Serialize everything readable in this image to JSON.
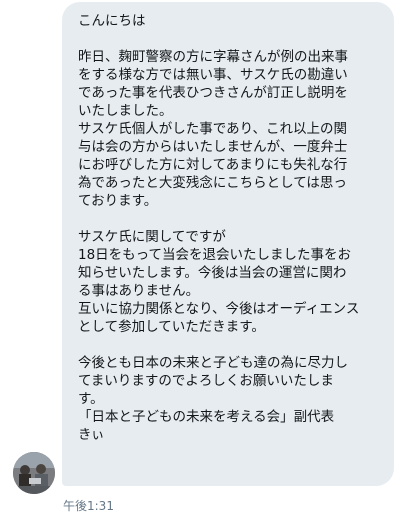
{
  "message": {
    "text": "こんにちは\n\n昨日、麹町警察の方に字幕さんが例の出来事\nをする様な方では無い事、サスケ氏の勘違い\nであった事を代表ひつきさんが訂正し説明を\nいたしました。\nサスケ氏個人がした事であり、これ以上の関\n与は会の方からはいたしませんが、一度弁士\nにお呼びした方に対してあまりにも失礼な行\n為であったと大変残念にこちらとしては思っ\nております。\n\nサスケ氏に関してですが\n18日をもって当会を退会いたしました事をお\n知らせいたします。今後は当会の運営に関わ\nる事はありません。\n互いに協力関係となり、今後はオーディエンス\nとして参加していただきます。\n\n今後とも日本の未来と子ども達の為に尽力し\nてまいりますのでよろしくお願いいたしま\nす。\n「日本と子どもの未来を考える会」副代表\nきぃ",
    "timestamp": "午後1:31"
  },
  "colors": {
    "bubble": "#e6ecf0",
    "text": "#14171a",
    "timestamp": "#657786"
  },
  "icons": {
    "avatar": "user-avatar-photo"
  }
}
